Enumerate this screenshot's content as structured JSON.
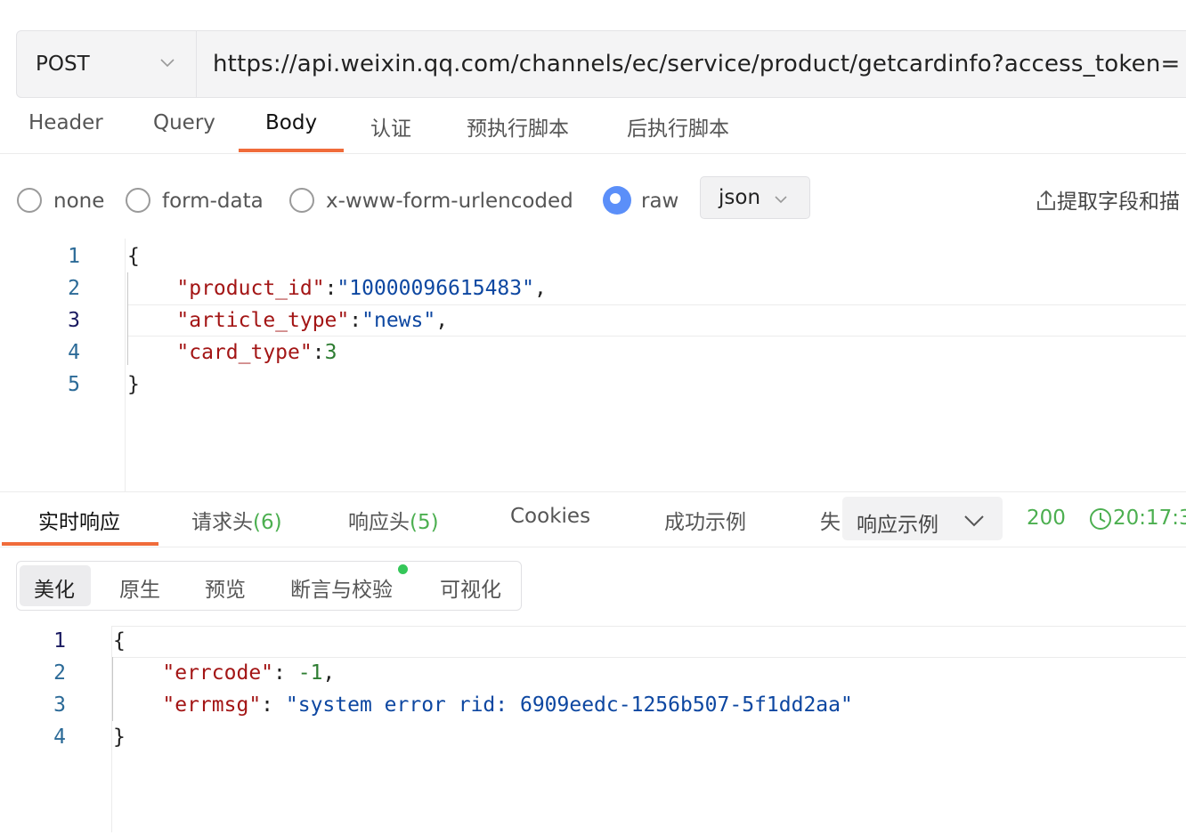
{
  "request": {
    "method": "POST",
    "url": "https://api.weixin.qq.com/channels/ec/service/product/getcardinfo?access_token="
  },
  "tabs": [
    "Header",
    "Query",
    "Body",
    "认证",
    "预执行脚本",
    "后执行脚本"
  ],
  "active_tab": "Body",
  "body_types": [
    "none",
    "form-data",
    "x-www-form-urlencoded",
    "raw"
  ],
  "selected_body_type": "raw",
  "format_select": "json",
  "extract_label": "提取字段和描",
  "request_body": {
    "line_numbers": [
      "1",
      "2",
      "3",
      "4",
      "5"
    ],
    "line1": "{",
    "product_id_key": "\"product_id\"",
    "product_id_val": "\"10000096615483\"",
    "article_type_key": "\"article_type\"",
    "article_type_val": "\"news\"",
    "card_type_key": "\"card_type\"",
    "card_type_val": "3",
    "line5": "}"
  },
  "response_tabs": {
    "realtime": "实时响应",
    "req_headers": "请求头",
    "req_headers_count": "(6)",
    "resp_headers": "响应头",
    "resp_headers_count": "(5)",
    "cookies": "Cookies",
    "success_example": "成功示例",
    "fail_partial": "失"
  },
  "response_example_select": "响应示例",
  "status_code": "200",
  "time": "20:17:3",
  "view_tabs": [
    "美化",
    "原生",
    "预览",
    "断言与校验",
    "可视化"
  ],
  "response_body": {
    "line_numbers": [
      "1",
      "2",
      "3",
      "4"
    ],
    "line1": "{",
    "errcode_key": "\"errcode\"",
    "errcode_val": "-1",
    "errmsg_key": "\"errmsg\"",
    "errmsg_val": "\"system error rid: 6909eedc-1256b507-5f1dd2aa\"",
    "line4": "}"
  },
  "colors": {
    "accent": "#f06c3a",
    "radio_checked": "#5b8ff9",
    "success": "#4caf50",
    "json_key": "#a31515",
    "json_string": "#0d47a1",
    "json_number": "#2e7d32"
  }
}
